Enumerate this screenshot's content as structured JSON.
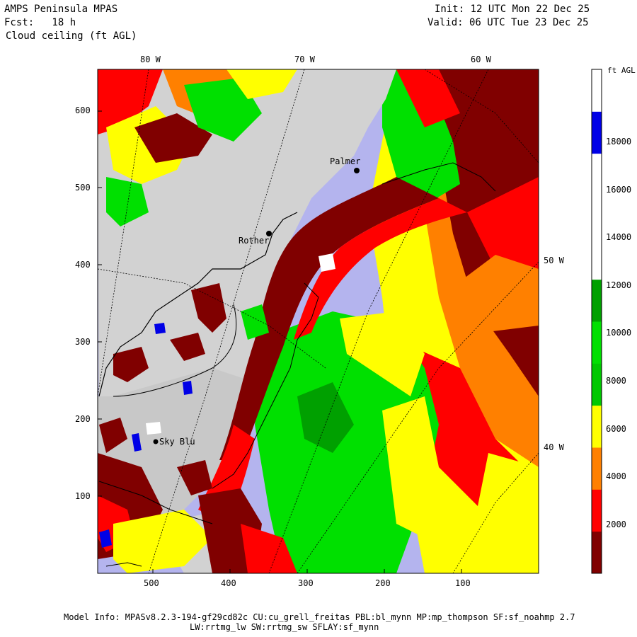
{
  "header": {
    "title": "AMPS Peninsula MPAS",
    "forecast": "Fcst:   18 h",
    "field": "Cloud ceiling (ft AGL)",
    "init": "Init: 12 UTC Mon 22 Dec 25",
    "valid": "Valid: 06 UTC Tue 23 Dec 25"
  },
  "axes": {
    "y_ticks": [
      "600",
      "500",
      "400",
      "300",
      "200",
      "100"
    ],
    "x_ticks": [
      "500",
      "400",
      "300",
      "200",
      "100"
    ],
    "lon_top": [
      "80 W",
      "70 W",
      "60 W"
    ],
    "lon_right": [
      "50 W",
      "40 W"
    ]
  },
  "stations": [
    "Palmer",
    "Rother",
    "Sky Blu"
  ],
  "colorbar": {
    "unit": "ft AGL",
    "labels": [
      "18000",
      "16000",
      "14000",
      "12000",
      "10000",
      "8000",
      "6000",
      "4000",
      "2000"
    ],
    "bins": [
      {
        "color": "#800000"
      },
      {
        "color": "#ff0000"
      },
      {
        "color": "#ff8000"
      },
      {
        "color": "#ffff00"
      },
      {
        "color": "#00c800"
      },
      {
        "color": "#00e000"
      },
      {
        "color": "#00a000"
      },
      {
        "color": "#ffffff"
      },
      {
        "color": "#ffffff"
      },
      {
        "color": "#ffffff"
      },
      {
        "color": "#0000e6"
      },
      {
        "color": "#ffffff"
      }
    ]
  },
  "colors": {
    "land": "#d2d2d2",
    "clear_sea": "#b4b4ee",
    "dark_red": "#800000",
    "red": "#ff0000",
    "orange": "#ff8000",
    "yellow": "#ffff00",
    "green": "#00e000",
    "dark_green": "#00a000",
    "blue": "#0000e6"
  },
  "footer": {
    "line1": "Model Info: MPASv8.2.3-194-gf29cd82c CU:cu_grell_freitas PBL:bl_mynn MP:mp_thompson SF:sf_noahmp 2.7",
    "line2": "LW:rrtmg_lw SW:rrtmg_sw SFLAY:sf_mynn"
  }
}
